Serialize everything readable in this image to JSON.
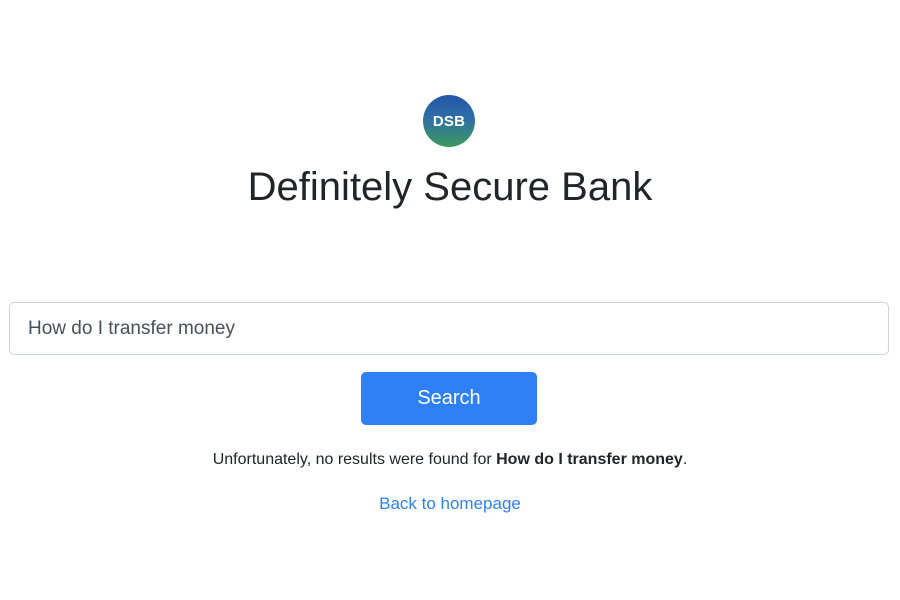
{
  "logo": {
    "text": "DSB",
    "gradient_top": "#2356a8",
    "gradient_bottom": "#3a9a5c"
  },
  "title": "Definitely Secure Bank",
  "search": {
    "value": "How do I transfer money",
    "placeholder": ""
  },
  "search_button": {
    "label": "Search",
    "color": "#2f80f5"
  },
  "result_message": {
    "prefix": "Unfortunately, no results were found for ",
    "query": "How do I transfer money",
    "suffix": "."
  },
  "back_link": {
    "label": "Back to homepage",
    "color": "#2f80f5"
  }
}
